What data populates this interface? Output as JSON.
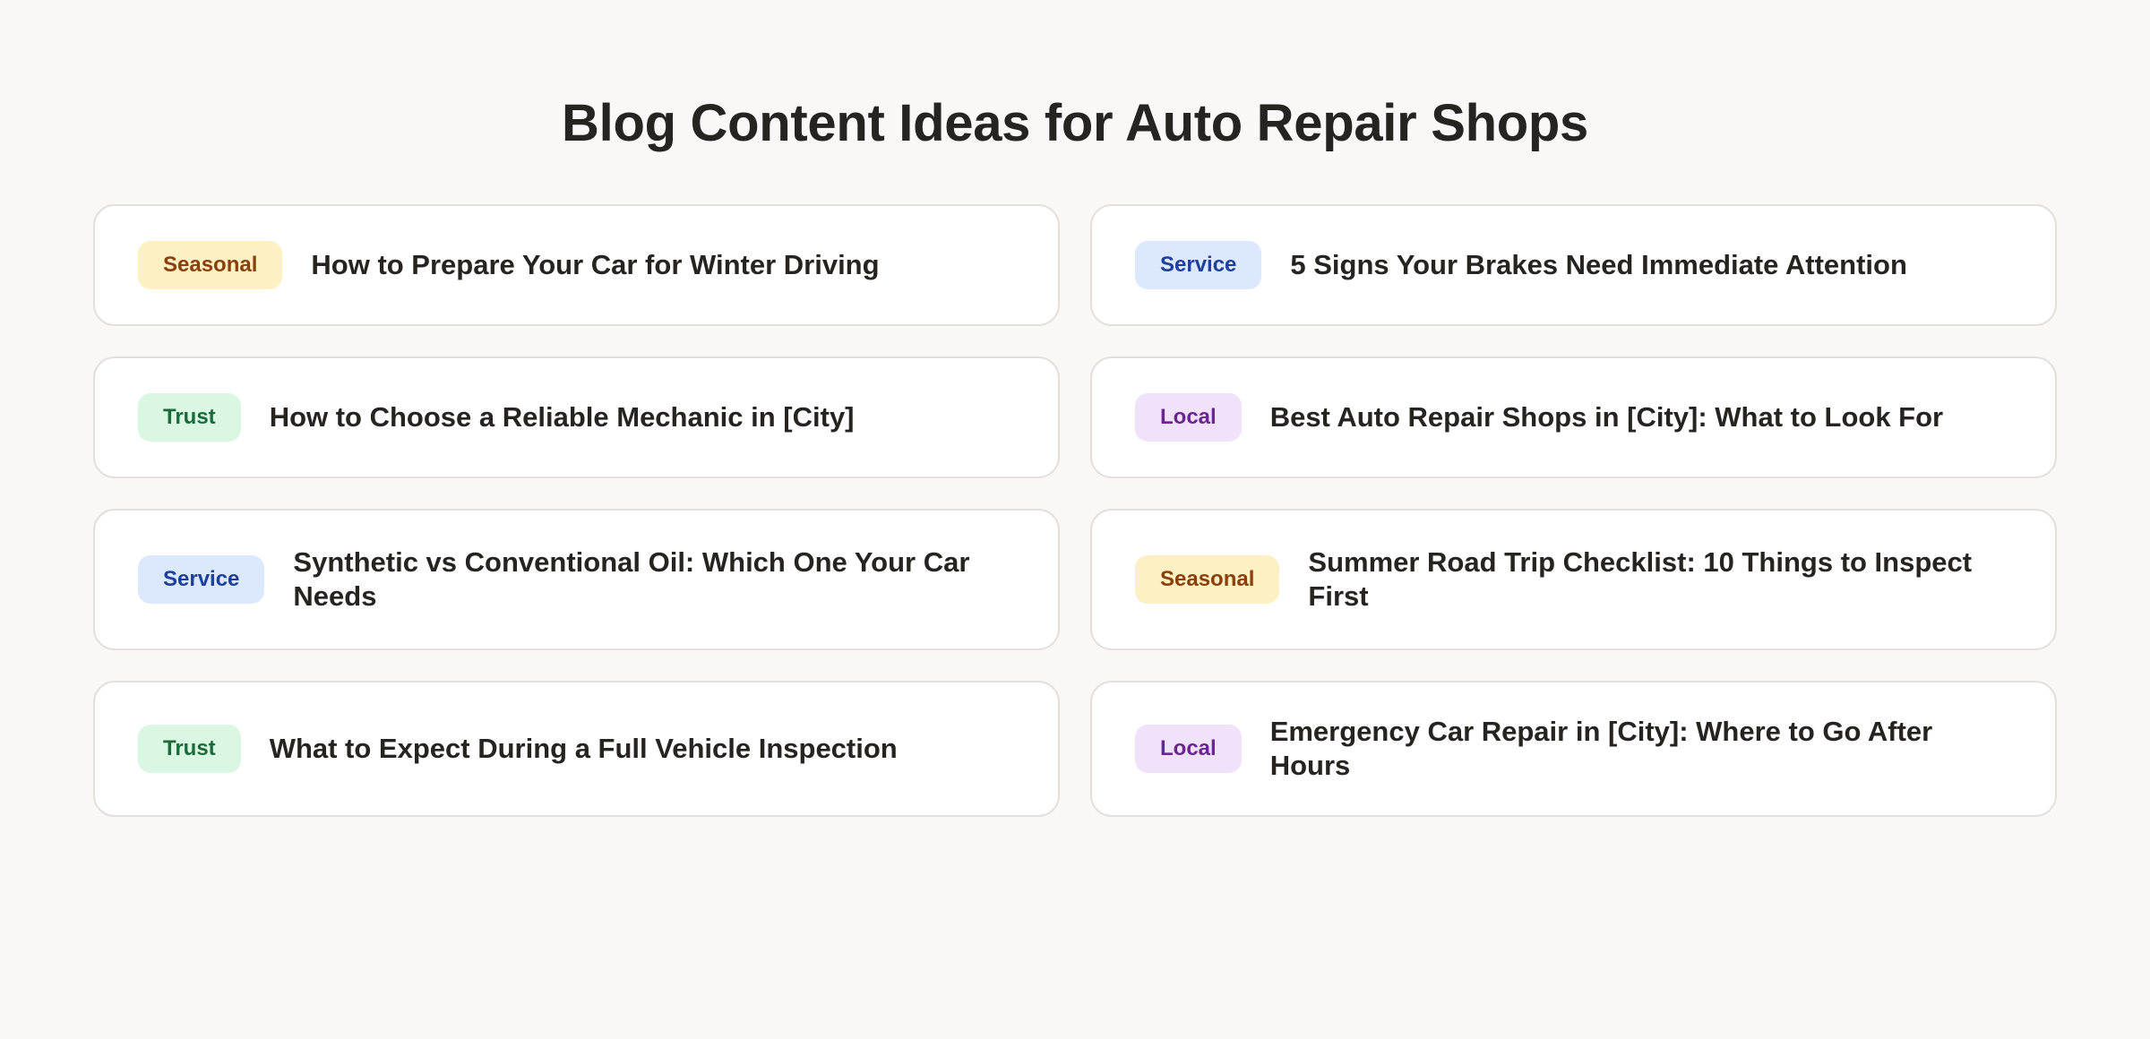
{
  "page": {
    "title": "Blog Content Ideas for Auto Repair Shops"
  },
  "colors": {
    "background": "#f9f8f6",
    "card": "#ffffff",
    "card_border": "#e2e0dc",
    "text": "#262420",
    "seasonal_bg": "#fdf1c3",
    "seasonal_text": "#8a3f0d",
    "service_bg": "#dbe8fd",
    "service_text": "#1e3f9e",
    "trust_bg": "#d9f7e3",
    "trust_text": "#1c6a3a",
    "local_bg": "#f1e2fb",
    "local_text": "#6b2590"
  },
  "ideas": [
    {
      "tag": "Seasonal",
      "title": "How to Prepare Your Car for Winter Driving"
    },
    {
      "tag": "Service",
      "title": "5 Signs Your Brakes Need Immediate Attention"
    },
    {
      "tag": "Trust",
      "title": "How to Choose a Reliable Mechanic in [City]"
    },
    {
      "tag": "Local",
      "title": "Best Auto Repair Shops in [City]: What to Look For"
    },
    {
      "tag": "Service",
      "title": "Synthetic vs Conventional Oil: Which One Your Car Needs"
    },
    {
      "tag": "Seasonal",
      "title": "Summer Road Trip Checklist: 10 Things to Inspect First"
    },
    {
      "tag": "Trust",
      "title": "What to Expect During a Full Vehicle Inspection"
    },
    {
      "tag": "Local",
      "title": "Emergency Car Repair in [City]: Where to Go After Hours"
    }
  ]
}
